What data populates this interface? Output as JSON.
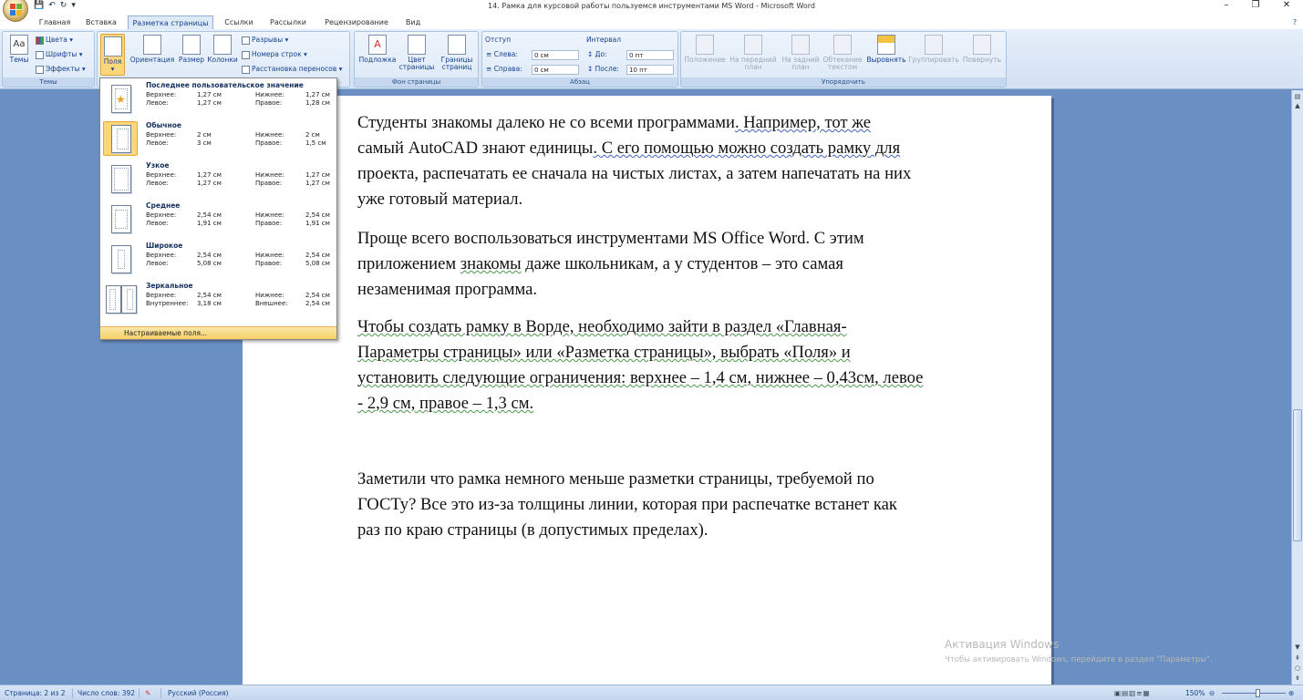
{
  "window": {
    "title": "14. Рамка для курсовой работы пользуемся инструментами MS Word - Microsoft Word",
    "minimize": "–",
    "restore": "❐",
    "close": "✕"
  },
  "qat": {
    "save": "💾",
    "undo": "↶",
    "redo": "↻",
    "more": "▾"
  },
  "tabs": [
    {
      "label": "Главная"
    },
    {
      "label": "Вставка"
    },
    {
      "label": "Разметка страницы"
    },
    {
      "label": "Ссылки"
    },
    {
      "label": "Рассылки"
    },
    {
      "label": "Рецензирование"
    },
    {
      "label": "Вид"
    }
  ],
  "ribbon": {
    "themes": {
      "big": "Темы",
      "colors": "Цвета",
      "fonts": "Шрифты",
      "effects": "Эффекты",
      "label": "Темы"
    },
    "page_setup": {
      "margins": "Поля",
      "orientation": "Ориентация",
      "size": "Размер",
      "columns": "Колонки",
      "breaks": "Разрывы",
      "line_numbers": "Номера строк",
      "hyphenation": "Расстановка переносов"
    },
    "background": {
      "watermark": "Подложка",
      "page_color_1": "Цвет",
      "page_color_2": "страницы",
      "borders_1": "Границы",
      "borders_2": "страниц",
      "label": "Фон страницы"
    },
    "paragraph": {
      "indent": "Отступ",
      "left": "Слева:",
      "left_val": "0 см",
      "right": "Справа:",
      "right_val": "0 см",
      "spacing": "Интервал",
      "before": "До:",
      "before_val": "0 пт",
      "after": "После:",
      "after_val": "10 пт",
      "label": "Абзац"
    },
    "arrange": {
      "position": "Положение",
      "front_1": "На передний",
      "front_2": "план",
      "back_1": "На задний",
      "back_2": "план",
      "wrap_1": "Обтекание",
      "wrap_2": "текстом",
      "align": "Выровнять",
      "group": "Группировать",
      "rotate": "Повернуть",
      "label": "Упорядочить"
    }
  },
  "margins_menu": {
    "items": [
      {
        "name": "Последнее пользовательское значение",
        "top_l": "Верхнее:",
        "top": "1,27 см",
        "bottom_l": "Нижнее:",
        "bottom": "1,27 см",
        "left_l": "Левое:",
        "left": "1,27 см",
        "right_l": "Правое:",
        "right": "1,28 см"
      },
      {
        "name": "Обычное",
        "top_l": "Верхнее:",
        "top": "2 см",
        "bottom_l": "Нижнее:",
        "bottom": "2 см",
        "left_l": "Левое:",
        "left": "3 см",
        "right_l": "Правое:",
        "right": "1,5 см"
      },
      {
        "name": "Узкое",
        "top_l": "Верхнее:",
        "top": "1,27 см",
        "bottom_l": "Нижнее:",
        "bottom": "1,27 см",
        "left_l": "Левое:",
        "left": "1,27 см",
        "right_l": "Правое:",
        "right": "1,27 см"
      },
      {
        "name": "Среднее",
        "top_l": "Верхнее:",
        "top": "2,54 см",
        "bottom_l": "Нижнее:",
        "bottom": "2,54 см",
        "left_l": "Левое:",
        "left": "1,91 см",
        "right_l": "Правое:",
        "right": "1,91 см"
      },
      {
        "name": "Широкое",
        "top_l": "Верхнее:",
        "top": "2,54 см",
        "bottom_l": "Нижнее:",
        "bottom": "2,54 см",
        "left_l": "Левое:",
        "left": "5,08 см",
        "right_l": "Правое:",
        "right": "5,08 см"
      },
      {
        "name": "Зеркальное",
        "top_l": "Верхнее:",
        "top": "2,54 см",
        "bottom_l": "Нижнее:",
        "bottom": "2,54 см",
        "left_l": "Внутреннее:",
        "left": "3,18 см",
        "right_l": "Внешнее:",
        "right": "2,54 см"
      }
    ],
    "custom": "Настраиваемые поля..."
  },
  "document": {
    "p1": [
      "Студенты знакомы далеко не со всеми программами",
      ". Например, тот же",
      "самый AutoCAD знают единицы",
      ". С его помощью можно создать рамку для",
      "проекта, распечатать ее сначала на чистых листах, а затем напечатать на них",
      "уже готовый материал."
    ],
    "p2": [
      "Проще всего воспользоваться инструментами MS Office Word. С этим",
      "приложением ",
      "знакомы",
      " даже школьникам, а у студентов – это самая",
      "незаменимая программа."
    ],
    "p3": [
      "Чтобы создать рамку в Ворде, необходимо зайти в раздел «Главная-",
      "Параметры страницы» или «Разметка страницы», выбрать «Поля» и",
      "установить следующие ограничения: верхнее – 1,4 см, нижнее – 0,43см, левое",
      "- 2,9 см, правое – 1,3 см."
    ],
    "p4": [
      "Заметили что рамка немного меньше разметки страницы, требуемой по",
      "ГОСТу? Все это из-за толщины линии, которая при распечатке встанет как",
      "раз по краю страницы (в допустимых пределах)."
    ]
  },
  "watermark": {
    "line1": "Активация Windows",
    "line2": "Чтобы активировать Windows, перейдите в раздел \"Параметры\"."
  },
  "status": {
    "page": "Страница: 2 из 2",
    "words": "Число слов: 392",
    "lang": "Русский (Россия)",
    "zoom": "150%"
  }
}
